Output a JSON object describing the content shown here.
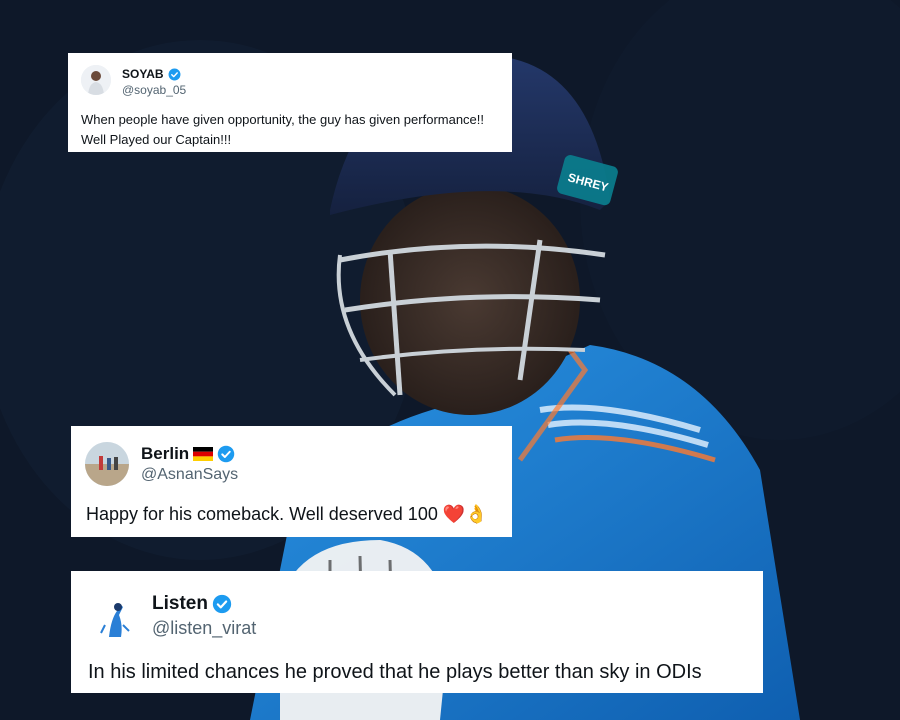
{
  "tweets": [
    {
      "name": "SOYAB",
      "handle": "@soyab_05",
      "text": "When people have given opportunity, the guy has given performance!! Well Played our Captain!!!",
      "verified": true
    },
    {
      "name": "Berlin",
      "handle": "@AsnanSays",
      "text": "Happy for his comeback. Well deserved 100",
      "emoji": "❤️👌",
      "verified": true,
      "flag": "germany-flag"
    },
    {
      "name": "Listen",
      "handle": "@listen_virat",
      "text": "In his limited chances he proved that he plays better than sky in ODIs",
      "verified": true
    }
  ],
  "background": {
    "helmet_text": "SHREY",
    "jersey_color": "#1a7fd1",
    "helmet_color": "#1b2b55"
  },
  "colors": {
    "verified": "#1d9bf0",
    "handle": "#536471",
    "text": "#0f1419"
  }
}
